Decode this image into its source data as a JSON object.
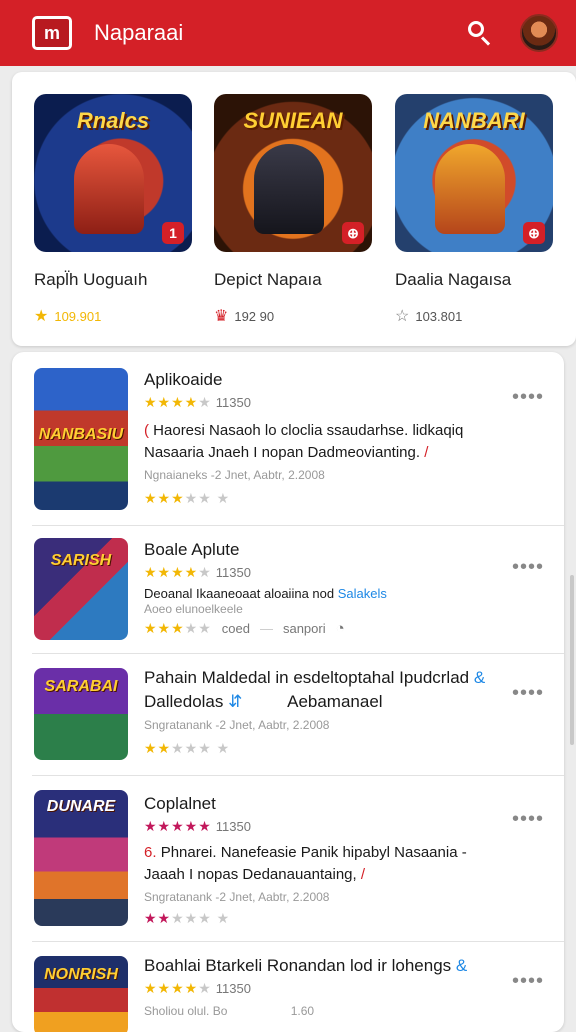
{
  "header": {
    "logo_text": "m",
    "title": "Naparaai"
  },
  "featured": [
    {
      "name": "Rapl̈h Uoguaıh",
      "rating": "109.901",
      "rating_icon": "star-icon",
      "art_title": "Rnalcs",
      "badge": "1"
    },
    {
      "name": "Depict Napaıa",
      "rating": "192 90",
      "rating_icon": "crown-icon",
      "art_title": "SUNIEAN",
      "badge": "⊕"
    },
    {
      "name": "Daalia Nagaısa",
      "rating": "103.801",
      "rating_icon": "star-outline-icon",
      "art_title": "NANBARI",
      "badge": "⊕"
    }
  ],
  "list": [
    {
      "title": "Aplikoaide",
      "rating": "11350",
      "desc": "Haoresi Nasaoh lo cloclia ssaudarhse. lidkaqiq Nasaaria Jnaeh I nopan Dadmeovianting.",
      "desc_prefix": "(",
      "desc_suffix": "/",
      "meta": "Ngnaianeks -2 Jnet, Aabtr, 2.2008",
      "art_title": "NANBASIU"
    },
    {
      "title": "Boale Aplute",
      "rating": "11350",
      "desc": "Deoanal Ikaaneoaat aloaiina nod",
      "desc_link": "Salakels",
      "meta": "Aoeo elunoelkeele",
      "tag_a": "coed",
      "tag_b": "sanpori",
      "art_title": "SARISH"
    },
    {
      "title": "Pahain Maldedal in esdeltoptahal Ipudcrlad",
      "title_suffix": "&",
      "title2": "Dalledolas",
      "title2_suffix": "Aebamanael",
      "meta": "Sngratanank -2 Jnet, Aabtr, 2.2008",
      "art_title": "SARABAI"
    },
    {
      "title": "Coplalnet",
      "rating": "11350",
      "desc": "Phnarei. Nanefeasie Panik hipabyl Nasaania -Jaaah I nopas Dedanauantaing,",
      "desc_prefix": "6.",
      "desc_suffix": "/",
      "meta": "Sngratanank -2 Jnet, Aabtr, 2.2008",
      "art_title": "DUNARE"
    },
    {
      "title": "Boahlai Btarkeli Ronandan lod ir lohengs",
      "title_suffix": "&",
      "rating": "11350",
      "meta": "Sholiou olul. Bo",
      "meta_right": "1.60",
      "art_title": "NONRISH"
    }
  ],
  "colors": {
    "brand": "#d42027",
    "star": "#f2b705",
    "accent_blue": "#1e88e5"
  }
}
